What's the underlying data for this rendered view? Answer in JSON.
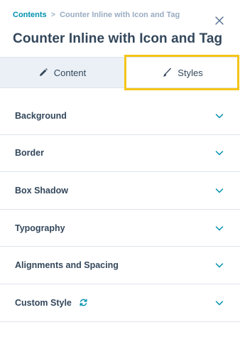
{
  "breadcrumb": {
    "root": "Contents",
    "separator": ">",
    "current": "Counter Inline with Icon and Tag"
  },
  "title": "Counter Inline with Icon and Tag",
  "tabs": [
    {
      "label": "Content",
      "icon": "pencil-icon",
      "active": false
    },
    {
      "label": "Styles",
      "icon": "brush-icon",
      "active": true
    }
  ],
  "sections": [
    {
      "label": "Background"
    },
    {
      "label": "Border"
    },
    {
      "label": "Box Shadow"
    },
    {
      "label": "Typography"
    },
    {
      "label": "Alignments and Spacing"
    },
    {
      "label": "Custom Style",
      "extra_icon": "refresh-icon"
    }
  ],
  "colors": {
    "accent": "#0091ae",
    "text": "#33475b",
    "highlight": "#f5c518",
    "tab_inactive_bg": "#eaf0f6"
  }
}
